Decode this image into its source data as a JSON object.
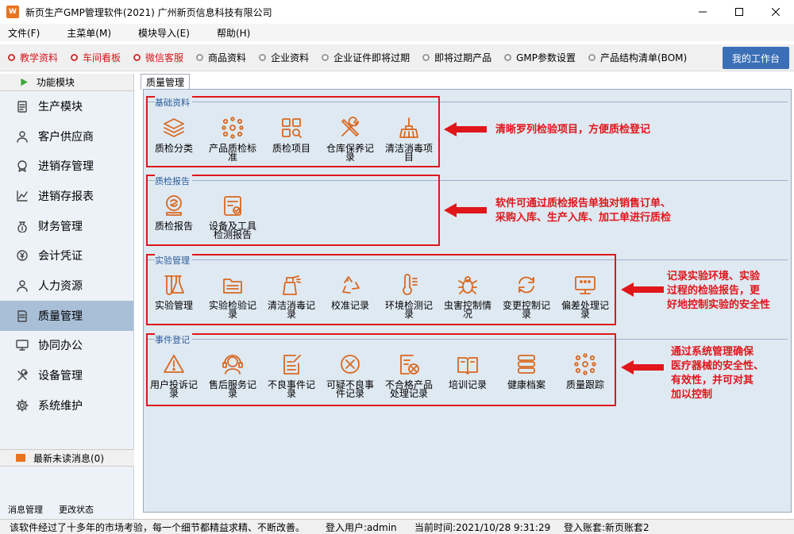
{
  "window": {
    "title": "新页生产GMP管理软件(2021) 广州新页信息科技有限公司",
    "logo_text": "W"
  },
  "menu": [
    "文件(F)",
    "主菜单(M)",
    "模块导入(E)",
    "帮助(H)"
  ],
  "toolbar": {
    "items": [
      {
        "label": "教学资料",
        "highlight": true
      },
      {
        "label": "车间看板",
        "highlight": true
      },
      {
        "label": "微信客服",
        "highlight": true
      },
      {
        "label": "商品资料",
        "highlight": false
      },
      {
        "label": "企业资料",
        "highlight": false
      },
      {
        "label": "企业证件即将过期",
        "highlight": false
      },
      {
        "label": "即将过期产品",
        "highlight": false
      },
      {
        "label": "GMP参数设置",
        "highlight": false
      },
      {
        "label": "产品结构清单(BOM)",
        "highlight": false
      }
    ],
    "workbench": "我的工作台"
  },
  "sidebar": {
    "header": "功能模块",
    "items": [
      {
        "label": "生产模块",
        "icon": "clipboard-icon"
      },
      {
        "label": "客户供应商",
        "icon": "person-icon"
      },
      {
        "label": "进销存管理",
        "icon": "medal-icon"
      },
      {
        "label": "进销存报表",
        "icon": "chart-icon"
      },
      {
        "label": "财务管理",
        "icon": "money-bag-icon"
      },
      {
        "label": "会计凭证",
        "icon": "coin-icon"
      },
      {
        "label": "人力资源",
        "icon": "person-icon"
      },
      {
        "label": "质量管理",
        "icon": "document-icon"
      },
      {
        "label": "协同办公",
        "icon": "monitor-icon"
      },
      {
        "label": "设备管理",
        "icon": "tools-icon"
      },
      {
        "label": "系统维护",
        "icon": "gear-icon"
      }
    ],
    "active_index": 7,
    "messages": "最新未读消息(0)",
    "footer": [
      "消息管理",
      "更改状态"
    ]
  },
  "main": {
    "tab": "质量管理",
    "groups": [
      {
        "title": "基础资料",
        "modules": [
          {
            "label": "质检分类",
            "icon": "layers-icon"
          },
          {
            "label": "产品质检标准",
            "icon": "network-icon"
          },
          {
            "label": "质检项目",
            "icon": "grid-search-icon"
          },
          {
            "label": "仓库保养记录",
            "icon": "tools-icon"
          },
          {
            "label": "清洁消毒项目",
            "icon": "broom-icon"
          }
        ]
      },
      {
        "title": "质检报告",
        "modules": [
          {
            "label": "质检报告",
            "icon": "stamp-icon"
          },
          {
            "label": "设备及工具检测报告",
            "icon": "checklist-icon"
          }
        ]
      },
      {
        "title": "实验管理",
        "modules": [
          {
            "label": "实验管理",
            "icon": "flask-icon"
          },
          {
            "label": "实验检验记录",
            "icon": "folder-icon"
          },
          {
            "label": "清洁消毒记录",
            "icon": "spray-icon"
          },
          {
            "label": "校准记录",
            "icon": "recycle-icon"
          },
          {
            "label": "环境检测记录",
            "icon": "thermometer-icon"
          },
          {
            "label": "虫害控制情况",
            "icon": "bug-icon"
          },
          {
            "label": "变更控制记录",
            "icon": "refresh-icon"
          },
          {
            "label": "偏差处理记录",
            "icon": "screen-icon"
          }
        ]
      },
      {
        "title": "事件登记",
        "modules": [
          {
            "label": "用户投诉记录",
            "icon": "warning-icon"
          },
          {
            "label": "售后服务记录",
            "icon": "headset-icon"
          },
          {
            "label": "不良事件记录",
            "icon": "edit-doc-icon"
          },
          {
            "label": "可疑不良事件记录",
            "icon": "x-circle-icon"
          },
          {
            "label": "不合格产品处理记录",
            "icon": "doc-x-icon"
          },
          {
            "label": "培训记录",
            "icon": "book-icon"
          },
          {
            "label": "健康档案",
            "icon": "database-icon"
          },
          {
            "label": "质量跟踪",
            "icon": "network-icon"
          }
        ]
      }
    ],
    "annotations": [
      [
        "清晰罗列检验项目，方便质检登记"
      ],
      [
        "软件可通过质检报告单独对销售订单、",
        "采购入库、生产入库、加工单进行质检"
      ],
      [
        "记录实验环境、实验",
        "过程的检验报告，更",
        "好地控制实验的安全性"
      ],
      [
        "通过系统管理确保",
        "医疗器械的安全性、",
        "有效性，并可对其",
        "加以控制"
      ]
    ]
  },
  "status": {
    "slogan": "该软件经过了十多年的市场考验，每一个细节都精益求精、不断改善。",
    "user": "登入用户:admin",
    "time": "当前时间:2021/10/28 9:31:29",
    "account": "登入账套:新页账套2"
  },
  "colors": {
    "accent_red": "#e0161b",
    "icon_orange": "#d9681f",
    "panel_bg": "#dfe9f2",
    "active_side": "#a9bfd8",
    "workbench": "#3b6fb6"
  }
}
